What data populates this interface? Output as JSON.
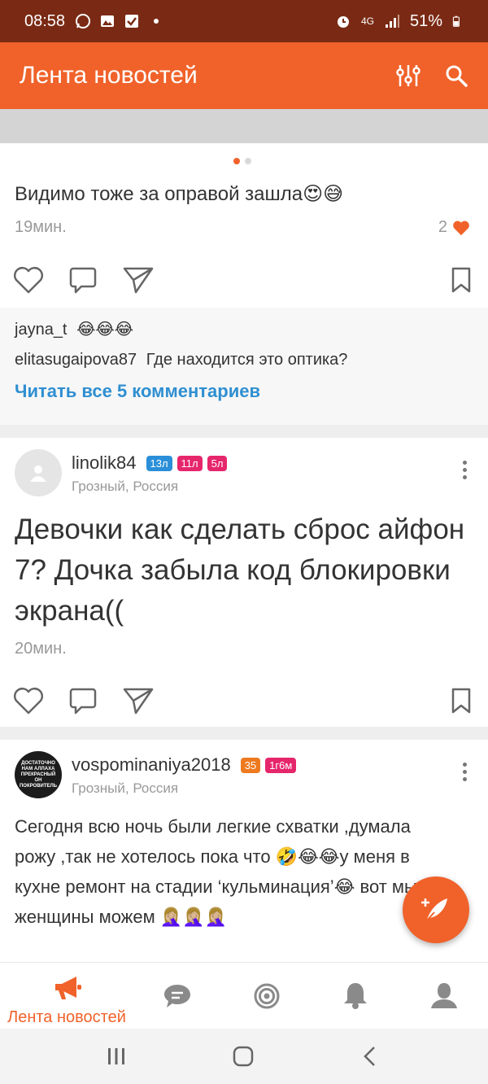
{
  "status_bar": {
    "time": "08:58",
    "battery": "51%",
    "network": "4G"
  },
  "app_bar": {
    "title": "Лента новостей"
  },
  "post1": {
    "text": "Видимо тоже за оправой зашла😍😅",
    "time": "19мин.",
    "likes": "2",
    "comments": [
      {
        "user": "jayna_t",
        "text": "😂😂😂"
      },
      {
        "user": "elitasugaipova87",
        "text": "Где находится это оптика?"
      }
    ],
    "read_all": "Читать все 5 комментариев"
  },
  "post2": {
    "user": "linolik84",
    "badges": [
      "13л",
      "11л",
      "5л"
    ],
    "location": "Грозный, Россия",
    "text": "Девочки как сделать сброс айфон 7? Дочка забыла код блокировки экрана((",
    "time": "20мин."
  },
  "post3": {
    "user": "vospominaniya2018",
    "badges": [
      "35",
      "1г6м"
    ],
    "location": "Грозный, Россия",
    "text": "Сегодня всю ночь были легкие схватки ,думала рожу ,так не хотелось пока что 🤣😂😂у меня в кухне ремонт на стадии ‘кульминация’😂 вот мы женщины можем 🤦🏼‍♀️🤦🏼‍♀️🤦🏼‍♀️",
    "avatar_text": "ДОСТАТОЧНО НАМ АЛЛАХА ПРЕКРАСНЫЙ ОН ПОКРОВИТЕЛЬ"
  },
  "bottom_nav": {
    "feed_label": "Лента новостей"
  },
  "colors": {
    "accent": "#f0622a",
    "link": "#2f8fd1",
    "statusbar": "#7a2a14"
  }
}
